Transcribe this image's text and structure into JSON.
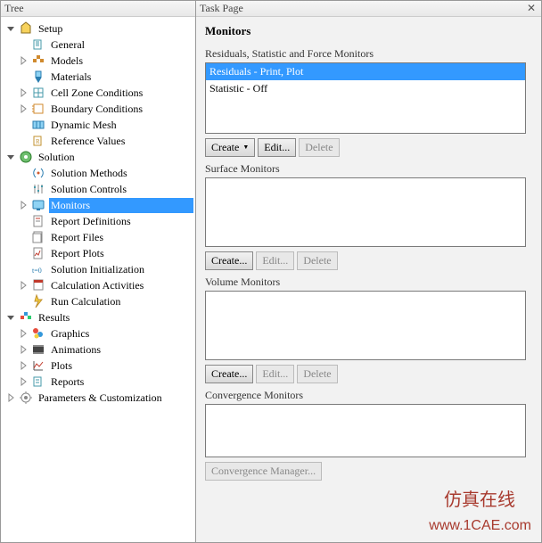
{
  "tree": {
    "header": "Tree",
    "nodes": [
      {
        "indent": 0,
        "exp": "open",
        "icon": "setup",
        "label": "Setup"
      },
      {
        "indent": 1,
        "exp": "none",
        "icon": "general",
        "label": "General"
      },
      {
        "indent": 1,
        "exp": "closed",
        "icon": "models",
        "label": "Models"
      },
      {
        "indent": 1,
        "exp": "none",
        "icon": "materials",
        "label": "Materials"
      },
      {
        "indent": 1,
        "exp": "closed",
        "icon": "cellzone",
        "label": "Cell Zone Conditions"
      },
      {
        "indent": 1,
        "exp": "closed",
        "icon": "boundary",
        "label": "Boundary Conditions"
      },
      {
        "indent": 1,
        "exp": "none",
        "icon": "mesh",
        "label": "Dynamic Mesh"
      },
      {
        "indent": 1,
        "exp": "none",
        "icon": "ref",
        "label": "Reference Values"
      },
      {
        "indent": 0,
        "exp": "open",
        "icon": "solution",
        "label": "Solution"
      },
      {
        "indent": 1,
        "exp": "none",
        "icon": "methods",
        "label": "Solution Methods"
      },
      {
        "indent": 1,
        "exp": "none",
        "icon": "controls",
        "label": "Solution Controls"
      },
      {
        "indent": 1,
        "exp": "closed",
        "icon": "monitors",
        "label": "Monitors",
        "selected": true
      },
      {
        "indent": 1,
        "exp": "none",
        "icon": "reportdef",
        "label": "Report Definitions"
      },
      {
        "indent": 1,
        "exp": "none",
        "icon": "reportfile",
        "label": "Report Files"
      },
      {
        "indent": 1,
        "exp": "none",
        "icon": "reportplot",
        "label": "Report Plots"
      },
      {
        "indent": 1,
        "exp": "none",
        "icon": "init",
        "label": "Solution Initialization"
      },
      {
        "indent": 1,
        "exp": "closed",
        "icon": "calcact",
        "label": "Calculation Activities"
      },
      {
        "indent": 1,
        "exp": "none",
        "icon": "runcalc",
        "label": "Run Calculation"
      },
      {
        "indent": 0,
        "exp": "open",
        "icon": "results",
        "label": "Results"
      },
      {
        "indent": 1,
        "exp": "closed",
        "icon": "graphics",
        "label": "Graphics"
      },
      {
        "indent": 1,
        "exp": "closed",
        "icon": "anim",
        "label": "Animations"
      },
      {
        "indent": 1,
        "exp": "closed",
        "icon": "plots",
        "label": "Plots"
      },
      {
        "indent": 1,
        "exp": "closed",
        "icon": "reports",
        "label": "Reports"
      },
      {
        "indent": 0,
        "exp": "closed",
        "icon": "params",
        "label": "Parameters & Customization"
      }
    ]
  },
  "task": {
    "header": "Task Page",
    "title": "Monitors",
    "residuals": {
      "label": "Residuals, Statistic and Force Monitors",
      "items": [
        {
          "text": "Residuals - Print, Plot",
          "selected": true
        },
        {
          "text": "Statistic - Off",
          "selected": false
        }
      ],
      "create": "Create",
      "edit": "Edit...",
      "delete": "Delete"
    },
    "surface": {
      "label": "Surface Monitors",
      "create": "Create...",
      "edit": "Edit...",
      "delete": "Delete"
    },
    "volume": {
      "label": "Volume Monitors",
      "create": "Create...",
      "edit": "Edit...",
      "delete": "Delete"
    },
    "convergence": {
      "label": "Convergence Monitors",
      "manager": "Convergence Manager..."
    }
  },
  "watermark": {
    "line1": "仿真在线",
    "line2": "www.1CAE.com"
  }
}
